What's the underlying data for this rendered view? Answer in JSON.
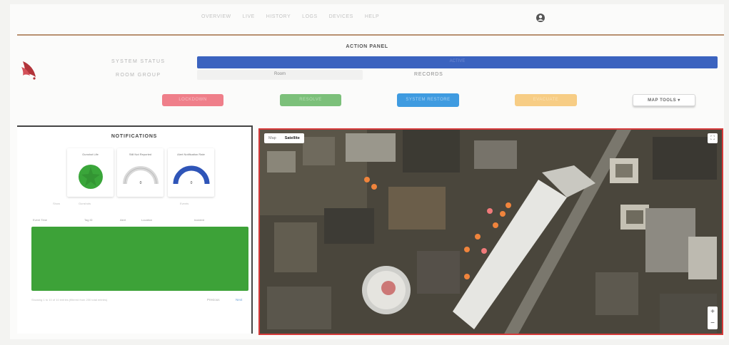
{
  "nav": {
    "items": [
      "OVERVIEW",
      "LIVE",
      "HISTORY",
      "LOGS",
      "DEVICES",
      "HELP"
    ]
  },
  "action_panel": {
    "title": "ACTION PANEL",
    "status_label": "SYSTEM STATUS",
    "status_value": "ACTIVE",
    "room_label": "ROOM GROUP",
    "room_value": "Room",
    "room_status": "RECORDS",
    "buttons": {
      "red": "LOCKDOWN",
      "green": "RESOLVE",
      "blue": "SYSTEM RESTORE",
      "yellow": "EVACUATE",
      "map_tools": "MAP TOOLS ▾"
    }
  },
  "notifications": {
    "title": "NOTIFICATIONS",
    "cards": [
      {
        "title": "Gunshot Life",
        "value": 0
      },
      {
        "title": "Still Not Reported",
        "value": 0
      },
      {
        "title": "Alert Notification Rate",
        "value": 0
      }
    ],
    "card_captions": [
      "Show",
      "Gunshots",
      "Events"
    ],
    "table_headers": [
      "Event Time",
      "Tag ID",
      "Alert",
      "Location",
      "Incident"
    ],
    "footer": "Showing 1 to 10 of 10 entries (filtered from 200 total entries)",
    "prev": "Previous",
    "next": "Next"
  },
  "map": {
    "type_options": [
      "Map",
      "Satellite"
    ],
    "selected_type": "Satellite",
    "fullscreen": "⛶",
    "zoom_in": "+",
    "zoom_out": "−"
  },
  "colors": {
    "status_bar": "#3b63bf",
    "gauge_green": "#3aa63a",
    "gauge_blue": "#2f55b8",
    "marker": "#f0843c",
    "map_border": "#d63a3a"
  }
}
